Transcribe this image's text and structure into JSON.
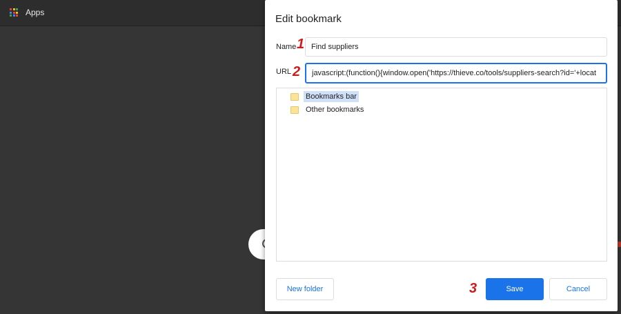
{
  "topbar": {
    "apps_label": "Apps"
  },
  "apps_icon_colors": [
    "#ea4335",
    "#fbbc05",
    "#34a853",
    "#4285f4",
    "#ea4335",
    "#fbbc05",
    "#34a853",
    "#4285f4",
    "#ea4335"
  ],
  "dialog": {
    "title": "Edit bookmark",
    "name_label": "Name",
    "name_value": "Find suppliers",
    "url_label": "URL",
    "url_value": "javascript:(function(){window.open('https://thieve.co/tools/suppliers-search?id='+locat",
    "folders": [
      {
        "label": "Bookmarks bar",
        "selected": true
      },
      {
        "label": "Other bookmarks",
        "selected": false
      }
    ],
    "new_folder_label": "New folder",
    "save_label": "Save",
    "cancel_label": "Cancel"
  },
  "annotations": {
    "step1": "1",
    "step2": "2",
    "step3": "3"
  },
  "colors": {
    "accent": "#1a73e8",
    "annotation": "#cc1d1d",
    "selection": "#cfe0f7",
    "folder": "#fbe49a"
  }
}
